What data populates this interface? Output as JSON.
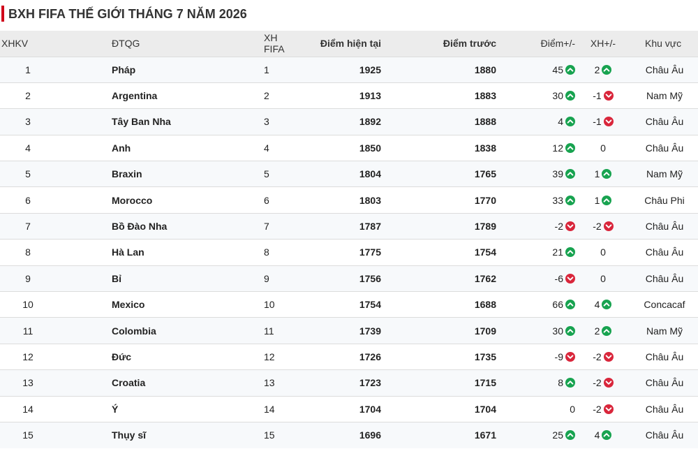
{
  "title": "BXH FIFA THẾ GIỚI THÁNG 7 NĂM 2026",
  "columns": {
    "rank": "XHKV",
    "team": "ĐTQG",
    "fifa": "XH FIFA",
    "current": "Điểm hiện tại",
    "previous": "Điểm trước",
    "points_change": "Điểm+/-",
    "rank_change": "XH+/-",
    "region": "Khu vực"
  },
  "colors": {
    "up": "#18a350",
    "down": "#d9263b",
    "accent": "#d0021b"
  },
  "rows": [
    {
      "rank": "1",
      "team": "Pháp",
      "fifa": "1",
      "current": "1925",
      "previous": "1880",
      "pts": "45",
      "pts_dir": "up",
      "rk": "2",
      "rk_dir": "up",
      "region": "Châu Âu"
    },
    {
      "rank": "2",
      "team": "Argentina",
      "fifa": "2",
      "current": "1913",
      "previous": "1883",
      "pts": "30",
      "pts_dir": "up",
      "rk": "-1",
      "rk_dir": "down",
      "region": "Nam Mỹ"
    },
    {
      "rank": "3",
      "team": "Tây Ban Nha",
      "fifa": "3",
      "current": "1892",
      "previous": "1888",
      "pts": "4",
      "pts_dir": "up",
      "rk": "-1",
      "rk_dir": "down",
      "region": "Châu Âu"
    },
    {
      "rank": "4",
      "team": "Anh",
      "fifa": "4",
      "current": "1850",
      "previous": "1838",
      "pts": "12",
      "pts_dir": "up",
      "rk": "0",
      "rk_dir": "none",
      "region": "Châu Âu"
    },
    {
      "rank": "5",
      "team": "Braxin",
      "fifa": "5",
      "current": "1804",
      "previous": "1765",
      "pts": "39",
      "pts_dir": "up",
      "rk": "1",
      "rk_dir": "up",
      "region": "Nam Mỹ"
    },
    {
      "rank": "6",
      "team": "Morocco",
      "fifa": "6",
      "current": "1803",
      "previous": "1770",
      "pts": "33",
      "pts_dir": "up",
      "rk": "1",
      "rk_dir": "up",
      "region": "Châu Phi"
    },
    {
      "rank": "7",
      "team": "Bồ Đào Nha",
      "fifa": "7",
      "current": "1787",
      "previous": "1789",
      "pts": "-2",
      "pts_dir": "down",
      "rk": "-2",
      "rk_dir": "down",
      "region": "Châu Âu"
    },
    {
      "rank": "8",
      "team": "Hà Lan",
      "fifa": "8",
      "current": "1775",
      "previous": "1754",
      "pts": "21",
      "pts_dir": "up",
      "rk": "0",
      "rk_dir": "none",
      "region": "Châu Âu"
    },
    {
      "rank": "9",
      "team": "Bỉ",
      "fifa": "9",
      "current": "1756",
      "previous": "1762",
      "pts": "-6",
      "pts_dir": "down",
      "rk": "0",
      "rk_dir": "none",
      "region": "Châu Âu"
    },
    {
      "rank": "10",
      "team": "Mexico",
      "fifa": "10",
      "current": "1754",
      "previous": "1688",
      "pts": "66",
      "pts_dir": "up",
      "rk": "4",
      "rk_dir": "up",
      "region": "Concacaf"
    },
    {
      "rank": "11",
      "team": "Colombia",
      "fifa": "11",
      "current": "1739",
      "previous": "1709",
      "pts": "30",
      "pts_dir": "up",
      "rk": "2",
      "rk_dir": "up",
      "region": "Nam Mỹ"
    },
    {
      "rank": "12",
      "team": "Đức",
      "fifa": "12",
      "current": "1726",
      "previous": "1735",
      "pts": "-9",
      "pts_dir": "down",
      "rk": "-2",
      "rk_dir": "down",
      "region": "Châu Âu"
    },
    {
      "rank": "13",
      "team": "Croatia",
      "fifa": "13",
      "current": "1723",
      "previous": "1715",
      "pts": "8",
      "pts_dir": "up",
      "rk": "-2",
      "rk_dir": "down",
      "region": "Châu Âu"
    },
    {
      "rank": "14",
      "team": "Ý",
      "fifa": "14",
      "current": "1704",
      "previous": "1704",
      "pts": "0",
      "pts_dir": "none",
      "rk": "-2",
      "rk_dir": "down",
      "region": "Châu Âu"
    },
    {
      "rank": "15",
      "team": "Thụy sĩ",
      "fifa": "15",
      "current": "1696",
      "previous": "1671",
      "pts": "25",
      "pts_dir": "up",
      "rk": "4",
      "rk_dir": "up",
      "region": "Châu Âu"
    }
  ]
}
